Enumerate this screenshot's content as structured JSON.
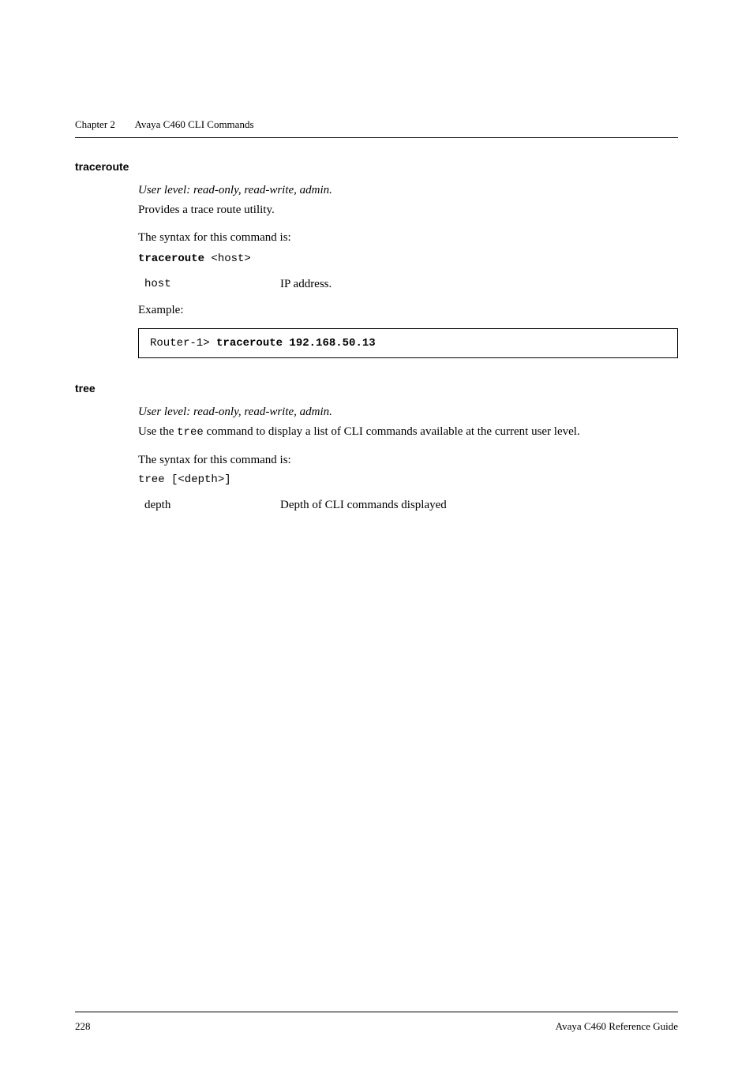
{
  "header": {
    "chapter_label": "Chapter 2",
    "chapter_title": "Avaya C460 CLI Commands"
  },
  "sections": [
    {
      "heading": "traceroute",
      "user_level": "User level: read-only, read-write, admin.",
      "description": "Provides a trace route utility.",
      "syntax_intro": "The syntax for this command is:",
      "syntax_cmd": "traceroute",
      "syntax_arg": " <host>",
      "params": [
        {
          "name": "host",
          "desc": "IP address."
        }
      ],
      "example_label": "Example:",
      "example_prompt": "Router-1> ",
      "example_cmd": "traceroute 192.168.50.13"
    },
    {
      "heading": "tree",
      "user_level": "User level: read-only, read-write, admin.",
      "description_pre": "Use the ",
      "description_code": "tree",
      "description_post": " command to display a list of CLI commands available at the current user level.",
      "syntax_intro": "The syntax for this command is:",
      "syntax_line": "tree [<depth>]",
      "params": [
        {
          "name": "depth",
          "desc": "Depth of CLI commands displayed"
        }
      ]
    }
  ],
  "footer": {
    "page": "228",
    "guide": "Avaya C460 Reference Guide"
  }
}
